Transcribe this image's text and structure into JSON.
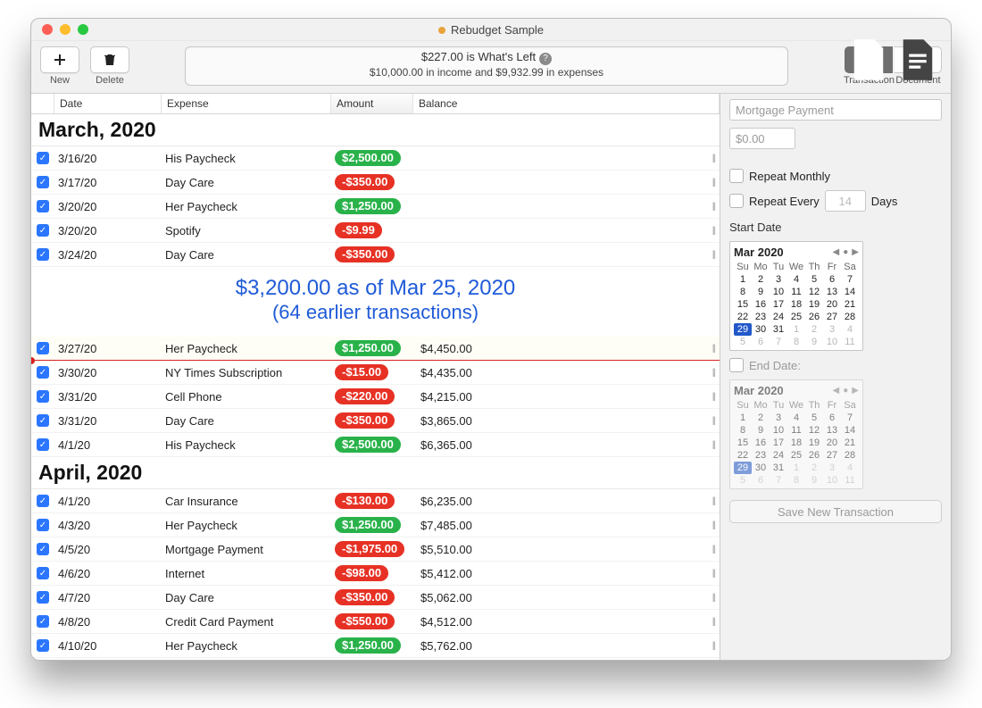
{
  "window": {
    "title": "Rebudget Sample",
    "modified": true
  },
  "toolbar": {
    "new_label": "New",
    "delete_label": "Delete",
    "summary_line1": "$227.00 is What's Left",
    "summary_line2": "$10,000.00 in income and $9,932.99 in expenses",
    "seg_transaction": "Transaction",
    "seg_document": "Document",
    "seg_selected": "Transaction"
  },
  "columns": {
    "date": "Date",
    "expense": "Expense",
    "amount": "Amount",
    "balance": "Balance"
  },
  "sections": [
    {
      "title": "March, 2020",
      "rows": [
        {
          "date": "3/16/20",
          "expense": "His Paycheck",
          "amount": "$2,500.00",
          "kind": "income"
        },
        {
          "date": "3/17/20",
          "expense": "Day Care",
          "amount": "-$350.00",
          "kind": "expense"
        },
        {
          "date": "3/20/20",
          "expense": "Her Paycheck",
          "amount": "$1,250.00",
          "kind": "income"
        },
        {
          "date": "3/20/20",
          "expense": "Spotify",
          "amount": "-$9.99",
          "kind": "expense"
        },
        {
          "date": "3/24/20",
          "expense": "Day Care",
          "amount": "-$350.00",
          "kind": "expense"
        }
      ],
      "summary": {
        "line1": "$3,200.00 as of Mar 25, 2020",
        "line2": "(64 earlier transactions)"
      },
      "rows2": [
        {
          "date": "3/27/20",
          "expense": "Her Paycheck",
          "amount": "$1,250.00",
          "kind": "income",
          "balance": "$4,450.00",
          "selected": true,
          "redline": true
        },
        {
          "date": "3/30/20",
          "expense": "NY Times Subscription",
          "amount": "-$15.00",
          "kind": "expense",
          "balance": "$4,435.00"
        },
        {
          "date": "3/31/20",
          "expense": "Cell Phone",
          "amount": "-$220.00",
          "kind": "expense",
          "balance": "$4,215.00"
        },
        {
          "date": "3/31/20",
          "expense": "Day Care",
          "amount": "-$350.00",
          "kind": "expense",
          "balance": "$3,865.00"
        },
        {
          "date": "4/1/20",
          "expense": "His Paycheck",
          "amount": "$2,500.00",
          "kind": "income",
          "balance": "$6,365.00"
        }
      ]
    },
    {
      "title": "April, 2020",
      "rows": [
        {
          "date": "4/1/20",
          "expense": "Car Insurance",
          "amount": "-$130.00",
          "kind": "expense",
          "balance": "$6,235.00"
        },
        {
          "date": "4/3/20",
          "expense": "Her Paycheck",
          "amount": "$1,250.00",
          "kind": "income",
          "balance": "$7,485.00"
        },
        {
          "date": "4/5/20",
          "expense": "Mortgage Payment",
          "amount": "-$1,975.00",
          "kind": "expense",
          "balance": "$5,510.00"
        },
        {
          "date": "4/6/20",
          "expense": "Internet",
          "amount": "-$98.00",
          "kind": "expense",
          "balance": "$5,412.00"
        },
        {
          "date": "4/7/20",
          "expense": "Day Care",
          "amount": "-$350.00",
          "kind": "expense",
          "balance": "$5,062.00"
        },
        {
          "date": "4/8/20",
          "expense": "Credit Card Payment",
          "amount": "-$550.00",
          "kind": "expense",
          "balance": "$4,512.00"
        },
        {
          "date": "4/10/20",
          "expense": "Her Paycheck",
          "amount": "$1,250.00",
          "kind": "income",
          "balance": "$5,762.00"
        }
      ]
    }
  ],
  "side": {
    "name_placeholder": "Mortgage Payment",
    "amount_placeholder": "$0.00",
    "repeat_monthly": "Repeat Monthly",
    "repeat_every": "Repeat Every",
    "repeat_n": "14",
    "repeat_unit": "Days",
    "start_date_label": "Start Date",
    "end_date_label": "End Date:",
    "save_label": "Save New Transaction",
    "cal": {
      "month": "Mar 2020",
      "dow": [
        "Su",
        "Mo",
        "Tu",
        "We",
        "Th",
        "Fr",
        "Sa"
      ],
      "weeks": [
        [
          {
            "n": 1
          },
          {
            "n": 2
          },
          {
            "n": 3
          },
          {
            "n": 4
          },
          {
            "n": 5
          },
          {
            "n": 6
          },
          {
            "n": 7
          }
        ],
        [
          {
            "n": 8
          },
          {
            "n": 9
          },
          {
            "n": 10
          },
          {
            "n": 11
          },
          {
            "n": 12
          },
          {
            "n": 13
          },
          {
            "n": 14
          }
        ],
        [
          {
            "n": 15
          },
          {
            "n": 16
          },
          {
            "n": 17
          },
          {
            "n": 18
          },
          {
            "n": 19
          },
          {
            "n": 20
          },
          {
            "n": 21
          }
        ],
        [
          {
            "n": 22
          },
          {
            "n": 23
          },
          {
            "n": 24
          },
          {
            "n": 25
          },
          {
            "n": 26
          },
          {
            "n": 27
          },
          {
            "n": 28
          }
        ],
        [
          {
            "n": 29,
            "sel": true
          },
          {
            "n": 30
          },
          {
            "n": 31
          },
          {
            "n": 1,
            "dim": true
          },
          {
            "n": 2,
            "dim": true
          },
          {
            "n": 3,
            "dim": true
          },
          {
            "n": 4,
            "dim": true
          }
        ],
        [
          {
            "n": 5,
            "dim": true
          },
          {
            "n": 6,
            "dim": true
          },
          {
            "n": 7,
            "dim": true
          },
          {
            "n": 8,
            "dim": true
          },
          {
            "n": 9,
            "dim": true
          },
          {
            "n": 10,
            "dim": true
          },
          {
            "n": 11,
            "dim": true
          }
        ]
      ]
    }
  }
}
